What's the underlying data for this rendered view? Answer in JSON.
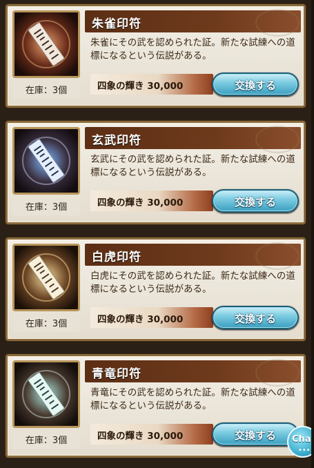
{
  "items": [
    {
      "name": "朱雀印符",
      "description": "朱雀にその武を認められた証。新たな試練への道標になるという伝説がある。",
      "price": "四象の輝き 30,000",
      "button": "交換する",
      "stock": "在庫：3個",
      "icon": "suzaku-seal-icon",
      "glow": "#e6a070"
    },
    {
      "name": "玄武印符",
      "description": "玄武にその武を認められた証。新たな試練への道標になるという伝説がある。",
      "price": "四象の輝き 30,000",
      "button": "交換する",
      "stock": "在庫：3個",
      "icon": "genbu-seal-icon",
      "glow": "#7fb6ff"
    },
    {
      "name": "白虎印符",
      "description": "白虎にその武を認められた証。新たな試練への道標になるという伝説がある。",
      "price": "四象の輝き 30,000",
      "button": "交換する",
      "stock": "在庫：3個",
      "icon": "byakko-seal-icon",
      "glow": "#f2d79a"
    },
    {
      "name": "青竜印符",
      "description": "青竜にその武を認められた証。新たな試練への道標になるという伝説がある。",
      "price": "四象の輝き 30,000",
      "button": "交換する",
      "stock": "在庫：3個",
      "icon": "seiryu-seal-icon",
      "glow": "#a9e6dc"
    }
  ],
  "chat": {
    "label": "Chat",
    "dots": "•••"
  }
}
